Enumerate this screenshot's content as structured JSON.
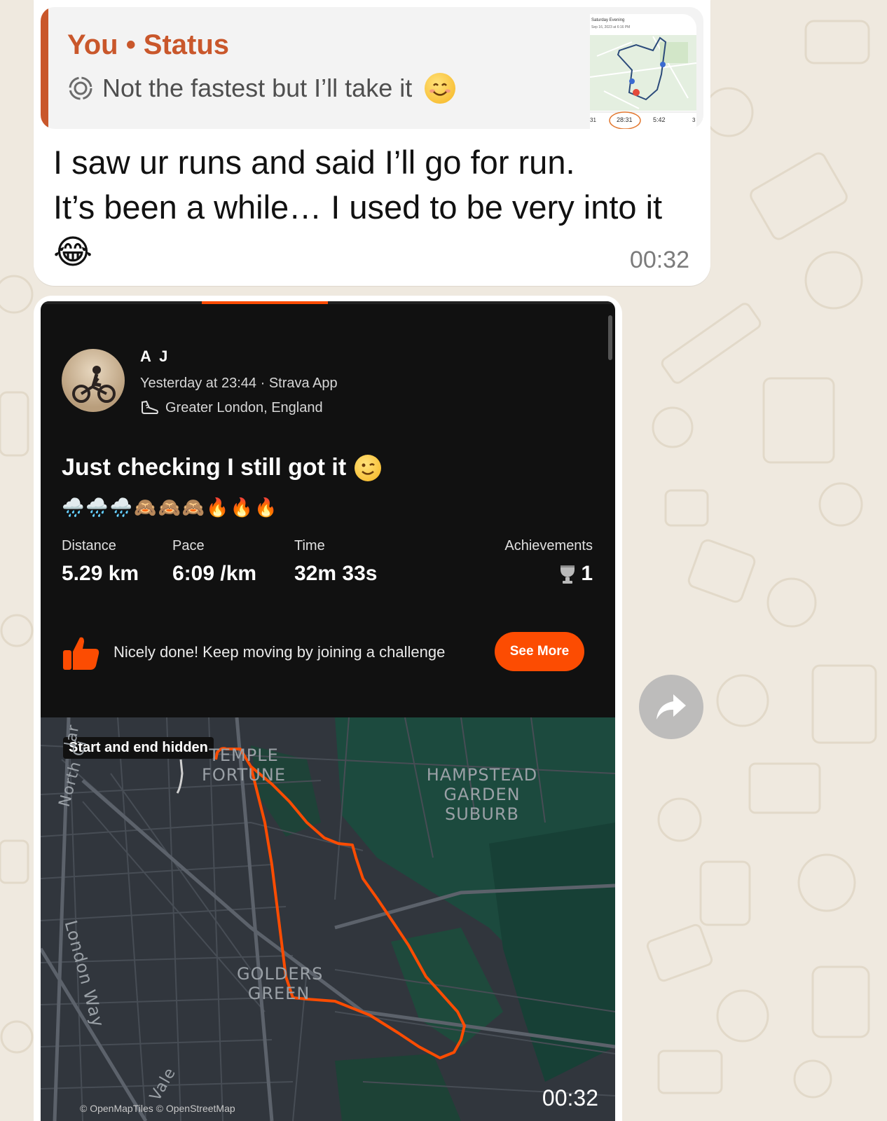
{
  "quoted_status": {
    "title": "You • Status",
    "text": "Not the fastest but I’ll take it",
    "thumbnail": {
      "header": "Saturday Evening",
      "subheader": "Sep 16, 2023 at 6:16 PM",
      "stats": [
        "31",
        "28:31",
        "5:42",
        "3"
      ]
    }
  },
  "message": {
    "line1": "I saw ur runs and said I’ll go for run.",
    "line2": "It’s been a while… I used  to be very into it",
    "emoji": "😂",
    "time": "00:32"
  },
  "activity": {
    "athlete": "A J",
    "meta": "Yesterday at 23:44 · Strava App",
    "location": "Greater London, England",
    "title": "Just checking I still got it",
    "emoji_row": "🌧️🌧️🌧️🙈🙈🙈🔥🔥🔥",
    "progress_fraction": 0.22,
    "stats": {
      "distance_label": "Distance",
      "distance_value": "5.29 km",
      "pace_label": "Pace",
      "pace_value": "6:09 /km",
      "time_label": "Time",
      "time_value": "32m 33s",
      "achievements_label": "Achievements",
      "achievements_value": "1"
    },
    "challenge_text": "Nicely done! Keep moving by joining a challenge",
    "see_more": "See More",
    "map": {
      "badge": "Start and end hidden",
      "label_temple": "TEMPLE FORTUNE",
      "label_hampstead": "HAMPSTEAD GARDEN SUBURB",
      "label_golders": "GOLDERS GREEN",
      "road_north": "North Ci",
      "road_lar": "lar",
      "road_london": "London Way",
      "road_vale": "Vale",
      "attribution": "© OpenMapTiles © OpenStreetMap"
    },
    "video_time": "00:32"
  },
  "colors": {
    "strava_orange": "#fc4c02",
    "quote_accent": "#c9572b",
    "card_bg": "#111111",
    "map_green": "#1c4a3e"
  },
  "icons": [
    "status-ring-icon",
    "smile-emoji-icon",
    "shoe-icon",
    "wink-emoji-icon",
    "trophy-icon",
    "thumbs-up-icon",
    "forward-icon"
  ]
}
